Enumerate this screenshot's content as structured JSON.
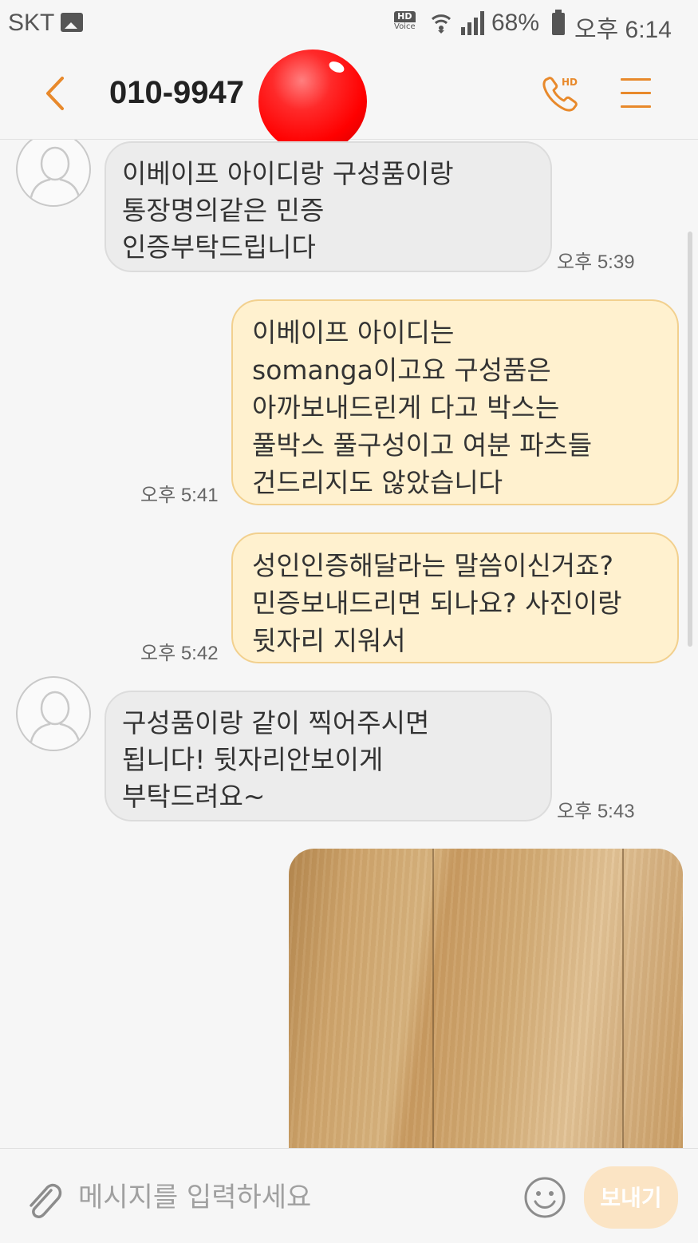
{
  "status_bar": {
    "carrier": "SKT",
    "hd_label": "HD",
    "voice_label": "Voice",
    "battery": "68%",
    "time": "오후 6:14",
    "icons": [
      "image-icon",
      "hd-voice-icon",
      "wifi-icon",
      "signal-icon",
      "battery-icon"
    ]
  },
  "header": {
    "title": "010-9947",
    "call_hd_label": "HD",
    "accent_color": "#e8892b",
    "icons": [
      "back-icon",
      "call-icon",
      "menu-icon"
    ]
  },
  "messages": [
    {
      "direction": "in",
      "lines": [
        "이베이프 아이디랑 구성품이랑",
        "통장명의같은 민증",
        "인증부탁드립니다"
      ],
      "time": "오후 5:39"
    },
    {
      "direction": "out",
      "lines": [
        "이베이프 아이디는",
        "somanga이고요 구성품은",
        "아까보내드린게 다고 박스는",
        "풀박스 풀구성이고 여분 파츠들",
        "건드리지도 않았습니다"
      ],
      "time": "오후 5:41"
    },
    {
      "direction": "out",
      "lines": [
        "성인인증해달라는 말씀이신거죠?",
        "민증보내드리면 되나요? 사진이랑",
        "뒷자리 지워서"
      ],
      "time": "오후 5:42"
    },
    {
      "direction": "in",
      "lines": [
        "구성품이랑 같이 찍어주시면",
        "됩니다! 뒷자리안보이게",
        "부탁드려요~"
      ],
      "time": "오후 5:43"
    },
    {
      "direction": "out",
      "type": "image"
    }
  ],
  "input_bar": {
    "placeholder": "메시지를 입력하세요",
    "send_label": "보내기",
    "icons": [
      "attach-icon",
      "emoji-icon"
    ]
  },
  "colors": {
    "incoming_bubble": "#ececec",
    "outgoing_bubble": "#fff1cf",
    "outgoing_border": "#f2d08e",
    "send_button": "#fbe4c4"
  }
}
